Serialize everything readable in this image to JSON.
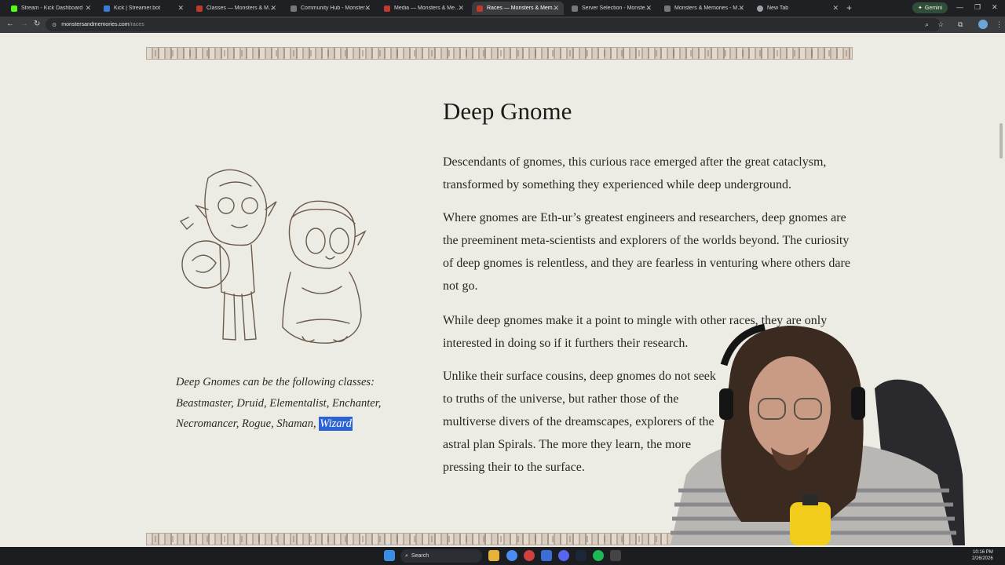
{
  "browser": {
    "tabs": [
      {
        "title": "Stream - Kick Dashboard",
        "color": "#53fc18"
      },
      {
        "title": "Kick | Streamer.bot",
        "color": "#3a7bd5"
      },
      {
        "title": "Classes — Monsters & Memories",
        "color": "#c0392b"
      },
      {
        "title": "Community Hub - Monsters & M",
        "color": "#777777"
      },
      {
        "title": "Media — Monsters & Memories",
        "color": "#c0392b"
      },
      {
        "title": "Races — Monsters & Memories",
        "color": "#c0392b"
      },
      {
        "title": "Server Selection - Monsters & M",
        "color": "#777777"
      },
      {
        "title": "Monsters & Memories - Monst",
        "color": "#777777"
      },
      {
        "title": "New Tab",
        "color": "#9aa0a6"
      }
    ],
    "gemini_label": "Gemini",
    "url_host": "monstersandmemories.com",
    "url_path": "/races"
  },
  "page": {
    "title": "Deep Gnome",
    "paragraphs": [
      "Descendants of gnomes, this curious race emerged after the great cataclysm, transformed by something they experienced while deep underground.",
      "Where gnomes are Eth-ur’s greatest engineers and researchers, deep gnomes are the preeminent meta-scientists and explorers of the worlds beyond. The curiosity of deep gnomes is relentless, and they are fearless in venturing where others dare not go.",
      "While deep gnomes make it a point to mingle with other races, they are only interested in doing so if it furthers their research.",
      "Unlike their surface cousins, deep gnomes do not seek to truths of the universe, but rather those of the multiverse divers of the dreamscapes, explorers of the astral plan Spirals. The more they learn, the more pressing their to the surface."
    ],
    "caption_text": "Deep Gnomes can be the following classes: Beastmaster, Druid, Elementalist, Enchanter, Necromancer, Rogue, Shaman, ",
    "caption_highlight": "Wizard"
  },
  "taskbar": {
    "search_label": "Search",
    "time": "10:16 PM",
    "date": "2/26/2026"
  }
}
